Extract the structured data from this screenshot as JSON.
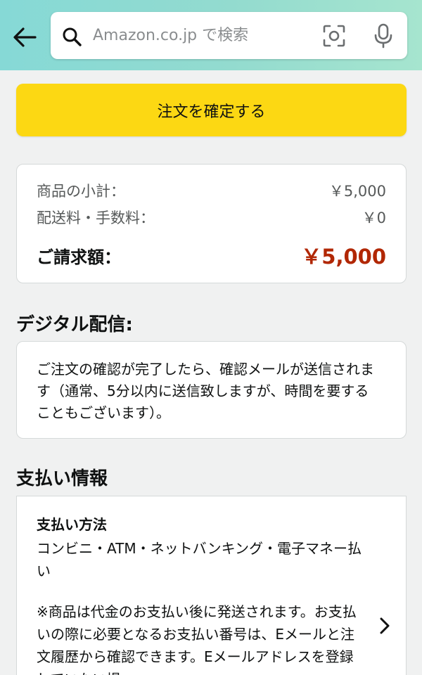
{
  "header": {
    "back_icon": "arrow-left-icon",
    "search_placeholder": "Amazon.co.jp で検索",
    "camera_icon": "camera-scan-icon",
    "mic_icon": "microphone-icon",
    "gradient_colors": [
      "#86d9d6",
      "#a6e5cf"
    ]
  },
  "confirm_button": {
    "label": "注文を確定する",
    "color": "#fcd813"
  },
  "summary": {
    "subtotal_label": "商品の小計：",
    "subtotal_value": "￥5,000",
    "shipping_label": "配送料・手数料：",
    "shipping_value": "￥0",
    "total_label": "ご請求額：",
    "total_value": "￥5,000",
    "total_color": "#b12704"
  },
  "digital": {
    "title": "デジタル配信:",
    "body": "ご注文の確認が完了したら、確認メールが送信されます（通常、5分以内に送信致しますが、時間を要することもございます）。"
  },
  "payment": {
    "title": "支払い情報",
    "method_heading": "支払い方法",
    "method_value": "コンビニ・ATM・ネットバンキング・電子マネー払い",
    "note": "※商品は代金のお支払い後に発送されます。お支払いの際に必要となるお支払い番号は、Eメールと注文履歴から確認できます。Eメールアドレスを登録していない場",
    "chevron_icon": "chevron-right-icon"
  }
}
